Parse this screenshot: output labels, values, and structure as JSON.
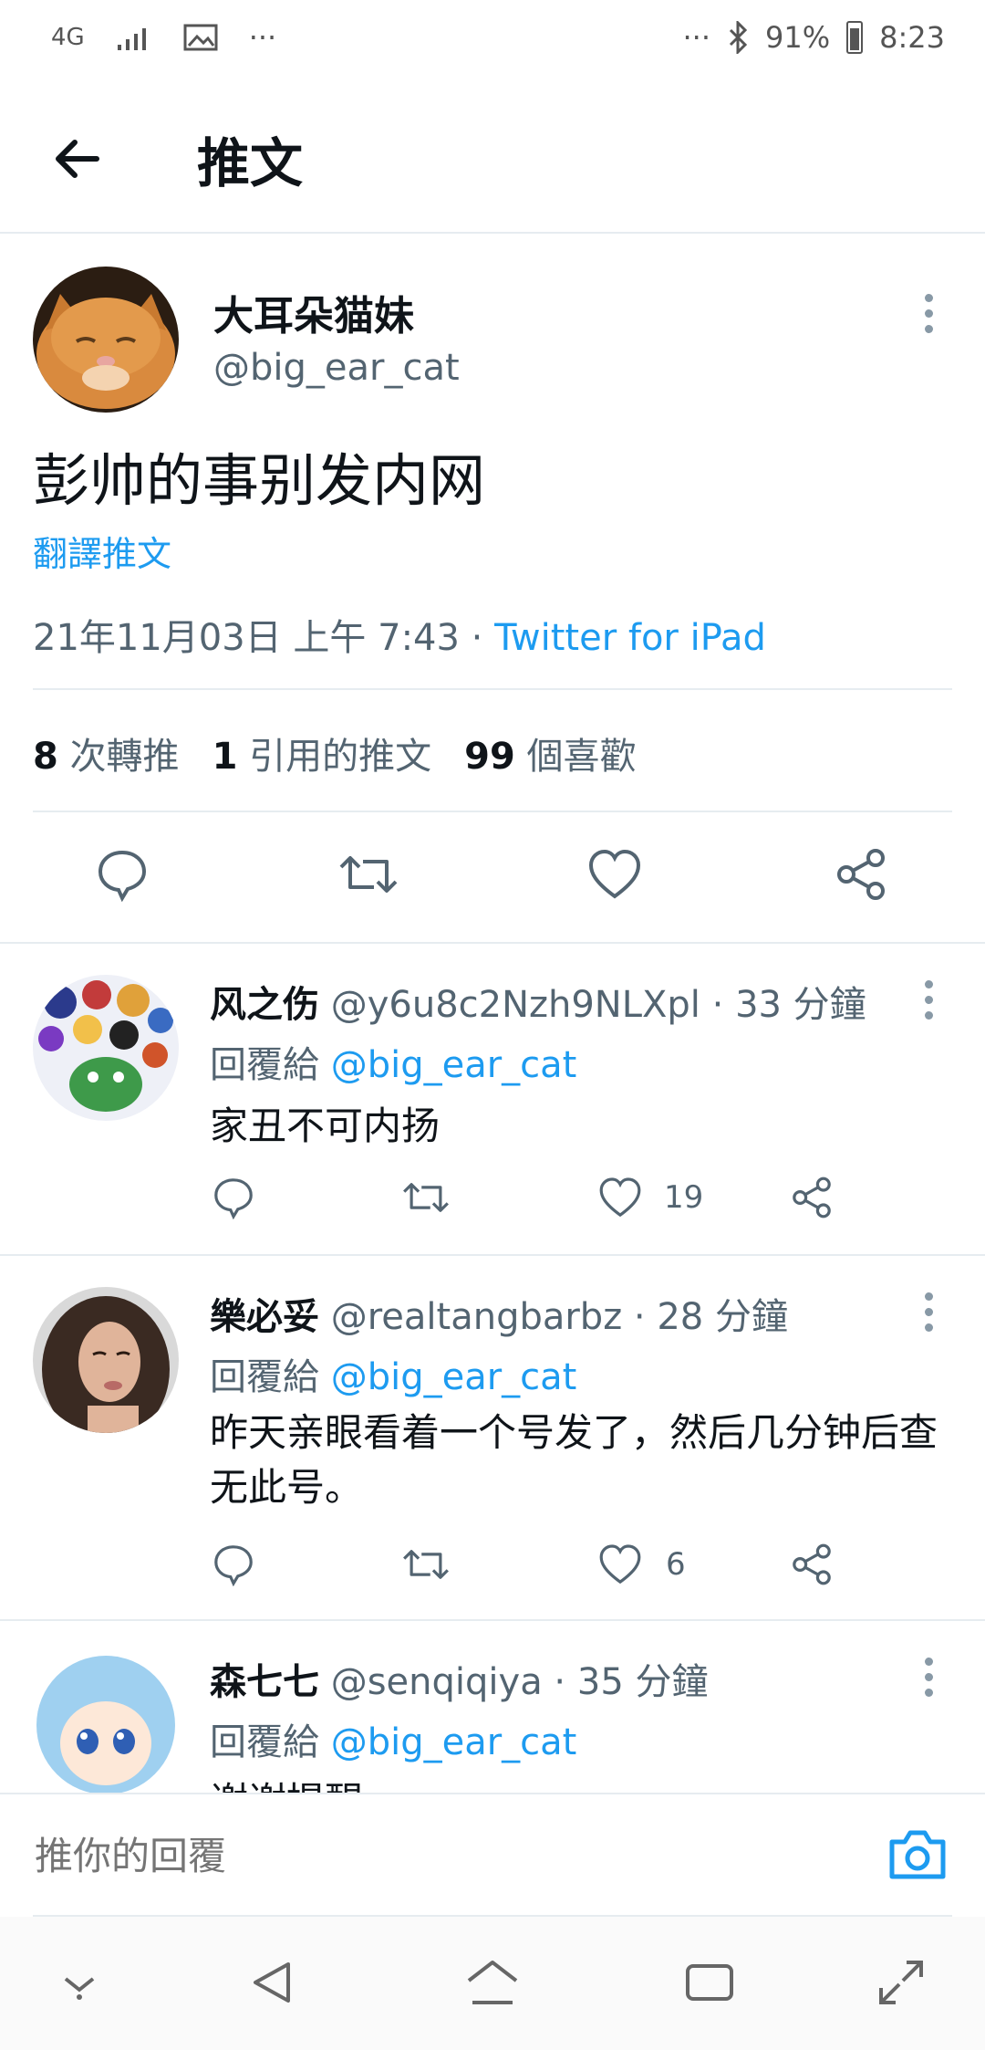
{
  "status_bar": {
    "network": "4G",
    "battery": "91%",
    "time": "8:23",
    "dots": "···"
  },
  "header": {
    "title": "推文"
  },
  "main_tweet": {
    "display_name": "大耳朵猫妹",
    "handle": "@big_ear_cat",
    "text": "彭帅的事别发内网",
    "translate": "翻譯推文",
    "timestamp": "21年11月03日 上午 7:43 · ",
    "source": "Twitter for iPad",
    "stats": [
      {
        "num": "8",
        "label": " 次轉推"
      },
      {
        "num": "1",
        "label": " 引用的推文"
      },
      {
        "num": "99",
        "label": " 個喜歡"
      }
    ]
  },
  "replies": [
    {
      "name": "风之伤",
      "handle": "@y6u8c2Nzh9NLXpl",
      "time": " · 33 分鐘",
      "reply_to_label": "回覆給 ",
      "reply_to": "@big_ear_cat",
      "text": "家丑不可内扬",
      "likes": "19"
    },
    {
      "name": "樂必妥",
      "handle": "@realtangbarbz",
      "time": " · 28 分鐘",
      "reply_to_label": "回覆給 ",
      "reply_to": "@big_ear_cat",
      "text": "昨天亲眼看着一个号发了，然后几分钟后查无此号。",
      "likes": "6"
    },
    {
      "name": "森七七",
      "handle": "@senqiqiya",
      "time": " · 35 分鐘",
      "reply_to_label": "回覆給 ",
      "reply_to": "@big_ear_cat",
      "text": "谢谢提醒",
      "likes": ""
    }
  ],
  "reply_input": {
    "placeholder": "推你的回覆"
  },
  "colors": {
    "accent": "#1d9bf0",
    "text": "#0f1419",
    "muted": "#536471",
    "divider": "#e6ecf0"
  }
}
